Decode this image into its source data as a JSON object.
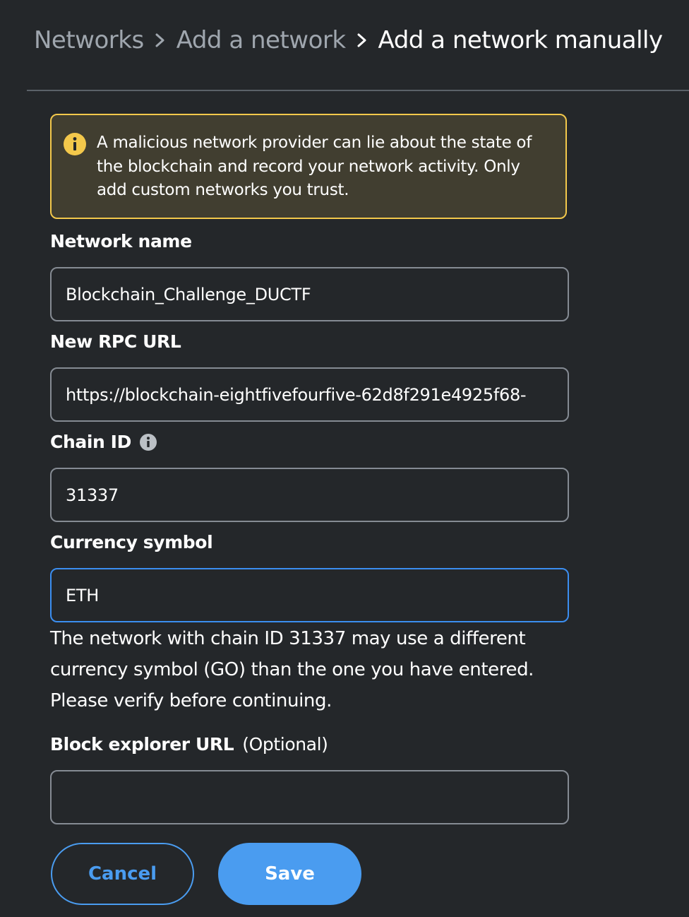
{
  "breadcrumb": {
    "items": [
      "Networks",
      "Add a network",
      "Add a network manually"
    ]
  },
  "warning": {
    "text": "A malicious network provider can lie about the state of the blockchain and record your network activity. Only add custom networks you trust."
  },
  "form": {
    "network_name": {
      "label": "Network name",
      "value": "Blockchain_Challenge_DUCTF"
    },
    "rpc_url": {
      "label": "New RPC URL",
      "value": "https://blockchain-eightfivefourfive-62d8f291e4925f68-"
    },
    "chain_id": {
      "label": "Chain ID",
      "value": "31337"
    },
    "currency_symbol": {
      "label": "Currency symbol",
      "value": "ETH",
      "helper": "The network with chain ID 31337 may use a different currency symbol (GO) than the one you have entered. Please verify before continuing."
    },
    "block_explorer": {
      "label": "Block explorer URL",
      "optional": "(Optional)",
      "value": ""
    }
  },
  "buttons": {
    "cancel": "Cancel",
    "save": "Save"
  },
  "colors": {
    "accent": "#4a9cf0",
    "warning_border": "#f3c84b",
    "warning_bg": "#413e30",
    "background": "#24272a"
  },
  "icons": {
    "warning": "info-circle-icon",
    "chain_id_info": "info-icon",
    "separator": "chevron-right-icon"
  }
}
